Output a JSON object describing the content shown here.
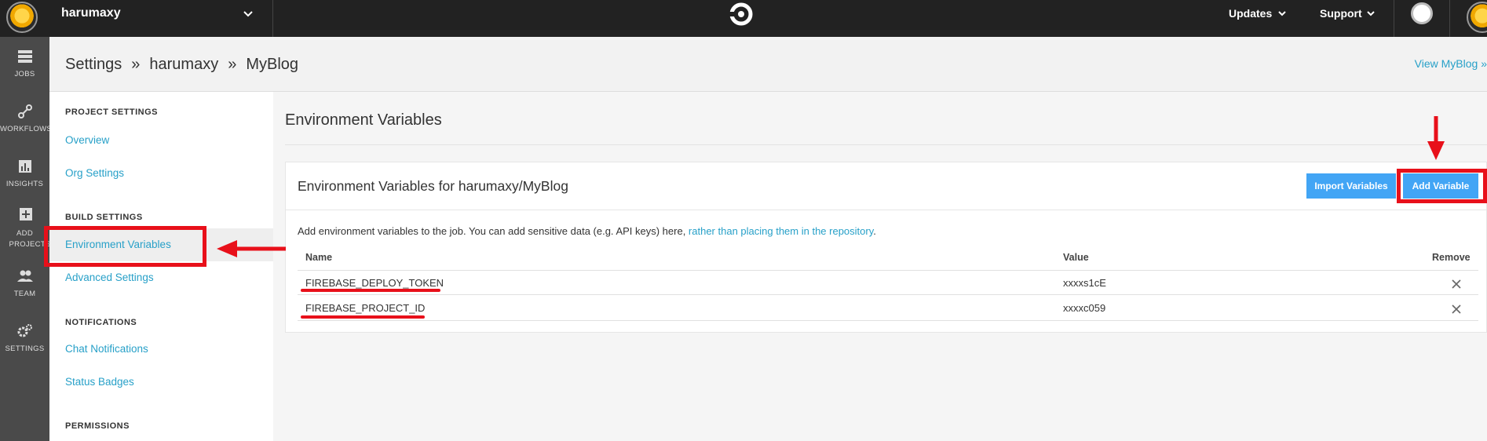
{
  "topbar": {
    "org_name": "harumaxy",
    "updates_label": "Updates",
    "support_label": "Support"
  },
  "rail": {
    "items": [
      {
        "label": "JOBS",
        "icon": "jobs-icon"
      },
      {
        "label": "WORKFLOWS",
        "icon": "workflows-icon"
      },
      {
        "label": "INSIGHTS",
        "icon": "insights-icon"
      },
      {
        "label": "ADD PROJECTS",
        "icon": "add-projects-icon"
      },
      {
        "label": "TEAM",
        "icon": "team-icon"
      },
      {
        "label": "SETTINGS",
        "icon": "settings-icon"
      }
    ]
  },
  "header": {
    "crumb1": "Settings",
    "sep": "»",
    "crumb2": "harumaxy",
    "crumb3": "MyBlog",
    "view_link": "View MyBlog »"
  },
  "sidebar": {
    "project_settings": "PROJECT SETTINGS",
    "overview": "Overview",
    "org_settings": "Org Settings",
    "build_settings": "BUILD SETTINGS",
    "env_vars": "Environment Variables",
    "advanced": "Advanced Settings",
    "notifications": "NOTIFICATIONS",
    "chat": "Chat Notifications",
    "badges": "Status Badges",
    "permissions": "PERMISSIONS"
  },
  "main": {
    "title": "Environment Variables",
    "card_title": "Environment Variables for harumaxy/MyBlog",
    "import_label": "Import Variables",
    "add_label": "Add Variable",
    "desc_text": "Add environment variables to the job. You can add sensitive data (e.g. API keys) here, ",
    "desc_link": "rather than placing them in the repository",
    "desc_end": ".",
    "columns": {
      "name": "Name",
      "value": "Value",
      "remove": "Remove"
    },
    "rows": [
      {
        "name": "FIREBASE_DEPLOY_TOKEN",
        "value": "xxxxs1cE"
      },
      {
        "name": "FIREBASE_PROJECT_ID",
        "value": "xxxxc059"
      }
    ]
  },
  "colors": {
    "accent_link": "#27a0c8",
    "button_blue": "#42a5f5",
    "annotation_red": "#e8101a",
    "topbar": "#222222",
    "rail": "#4a4a4a"
  }
}
